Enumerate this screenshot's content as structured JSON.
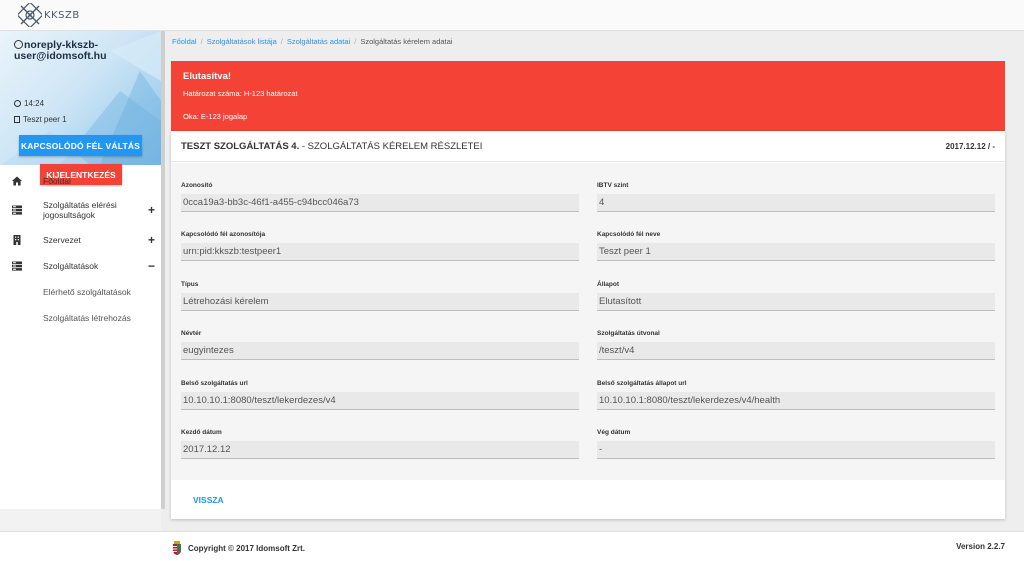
{
  "app": {
    "logo_text": "KKSZB"
  },
  "user": {
    "email": "noreply-kkszb-user@idomsoft.hu",
    "time": "14:24",
    "peer": "Teszt peer 1",
    "switch_label": "KAPCSOLÓDÓ FÉL VÁLTÁS",
    "logout_label": "KIJELENTKEZÉS"
  },
  "nav": {
    "items": [
      {
        "label": "Főoldal",
        "icon": "home-icon",
        "toggle": ""
      },
      {
        "label": "Szolgáltatás elérési jogosultságok",
        "icon": "server-icon",
        "toggle": "+"
      },
      {
        "label": "Szervezet",
        "icon": "building-icon",
        "toggle": "+"
      },
      {
        "label": "Szolgáltatások",
        "icon": "server-icon",
        "toggle": "−"
      }
    ],
    "subitems": [
      "Elérhető szolgáltatások",
      "Szolgáltatás létrehozás"
    ]
  },
  "breadcrumb": {
    "items": [
      "Főoldal",
      "Szolgáltatások listája",
      "Szolgáltatás adatai"
    ],
    "current": "Szolgáltatás kérelem adatai"
  },
  "alert": {
    "title": "Elutasítva!",
    "line1": "Határozat száma: H-123 határozat",
    "line2": "Oka: E-123 jogalap",
    "color": "#f44336"
  },
  "card": {
    "title_bold": "TESZT SZOLGÁLTATÁS 4.",
    "title_rest": " - SZOLGÁLTATÁS KÉRELEM RÉSZLETEI",
    "date": "2017.12.12 / -",
    "back_label": "VISSZA"
  },
  "fields": {
    "azonosito": {
      "label": "Azonosító",
      "value": "0cca19a3-bb3c-46f1-a455-c94bcc046a73"
    },
    "ibtv": {
      "label": "IBTV szint",
      "value": "4"
    },
    "peer_id": {
      "label": "Kapcsolódó fél azonosítója",
      "value": "urn:pid:kkszb:testpeer1"
    },
    "peer_name": {
      "label": "Kapcsolódó fél neve",
      "value": "Teszt peer 1"
    },
    "tipus": {
      "label": "Típus",
      "value": "Létrehozási kérelem"
    },
    "allapot": {
      "label": "Állapot",
      "value": "Elutasított"
    },
    "nevter": {
      "label": "Névtér",
      "value": "eugyintezes"
    },
    "utvonal": {
      "label": "Szolgáltatás útvonal",
      "value": "/teszt/v4"
    },
    "belso_url": {
      "label": "Belső szolgáltatás url",
      "value": "10.10.10.1:8080/teszt/lekerdezes/v4"
    },
    "belso_allapot_url": {
      "label": "Belső szolgáltatás állapot url",
      "value": "10.10.10.1:8080/teszt/lekerdezes/v4/health"
    },
    "kezdo": {
      "label": "Kezdő dátum",
      "value": "2017.12.12"
    },
    "veg": {
      "label": "Vég dátum",
      "value": "-"
    }
  },
  "footer": {
    "copyright": "Copyright © 2017 Idomsoft Zrt.",
    "version": "Version 2.2.7"
  },
  "colors": {
    "primary": "#2196f3",
    "danger": "#f44336"
  }
}
